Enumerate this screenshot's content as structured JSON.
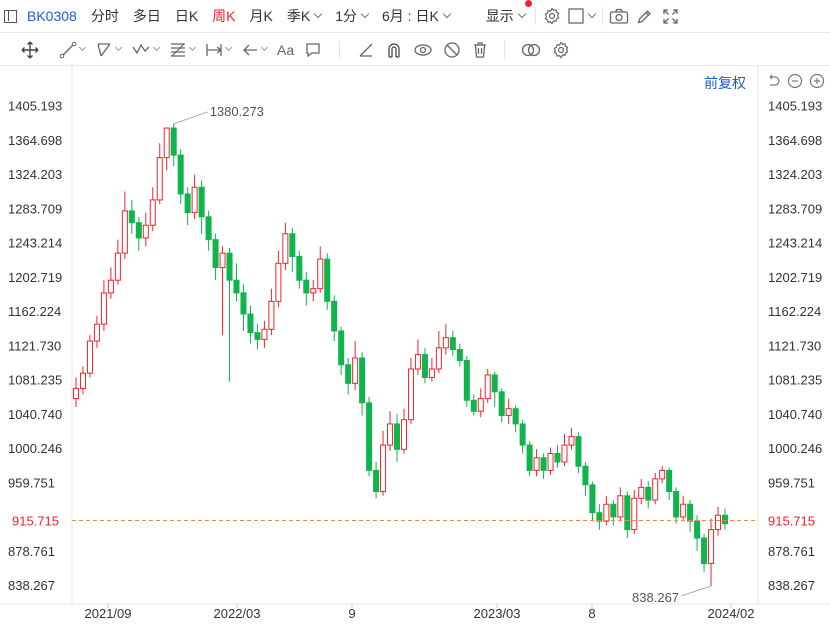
{
  "toolbar": {
    "symbol": "BK0308",
    "periods": [
      "分时",
      "多日",
      "日K",
      "周K",
      "月K",
      "季K",
      "1分"
    ],
    "active_period": "周K",
    "combo": "6月 : 日K",
    "display": "显示"
  },
  "drawbar": {
    "text_tool": "Aa"
  },
  "chart": {
    "adjust_label": "前复权",
    "current_price": "915.715"
  },
  "chart_data": {
    "type": "candlestick",
    "y_ticks": [
      "1405.193",
      "1364.698",
      "1324.203",
      "1283.709",
      "1243.214",
      "1202.719",
      "1162.224",
      "1121.730",
      "1081.235",
      "1040.740",
      "1000.246",
      "959.751",
      "878.761",
      "838.267"
    ],
    "ylim": [
      817,
      1425
    ],
    "x_ticks": [
      "2021/09",
      "2022/03",
      "9",
      "2023/03",
      "8",
      "2024/02"
    ],
    "high_label": "1380.273",
    "low_label": "838.267",
    "current_price": 915.715,
    "colors": {
      "up": "#f5222d",
      "down": "#10b44c",
      "price_line": "#f0883e"
    },
    "candles": [
      [
        1060,
        1072,
        1085,
        1050
      ],
      [
        1072,
        1090,
        1098,
        1065
      ],
      [
        1090,
        1128,
        1135,
        1085
      ],
      [
        1128,
        1148,
        1158,
        1120
      ],
      [
        1148,
        1185,
        1200,
        1140
      ],
      [
        1185,
        1200,
        1215,
        1178
      ],
      [
        1200,
        1232,
        1248,
        1195
      ],
      [
        1232,
        1282,
        1305,
        1225
      ],
      [
        1282,
        1268,
        1295,
        1255
      ],
      [
        1268,
        1250,
        1275,
        1235
      ],
      [
        1250,
        1265,
        1280,
        1240
      ],
      [
        1265,
        1295,
        1310,
        1258
      ],
      [
        1295,
        1345,
        1362,
        1290
      ],
      [
        1345,
        1380,
        1380.273,
        1330
      ],
      [
        1380,
        1348,
        1385,
        1335
      ],
      [
        1348,
        1302,
        1355,
        1290
      ],
      [
        1302,
        1280,
        1310,
        1265
      ],
      [
        1280,
        1310,
        1325,
        1272
      ],
      [
        1310,
        1275,
        1318,
        1255
      ],
      [
        1275,
        1248,
        1282,
        1235
      ],
      [
        1248,
        1215,
        1255,
        1200
      ],
      [
        1215,
        1232,
        1240,
        1135
      ],
      [
        1232,
        1200,
        1238,
        1080
      ],
      [
        1200,
        1185,
        1220,
        1175
      ],
      [
        1185,
        1160,
        1195,
        1140
      ],
      [
        1160,
        1138,
        1170,
        1125
      ],
      [
        1138,
        1130,
        1148,
        1118
      ],
      [
        1130,
        1142,
        1152,
        1120
      ],
      [
        1142,
        1175,
        1190,
        1135
      ],
      [
        1175,
        1220,
        1235,
        1168
      ],
      [
        1220,
        1255,
        1268,
        1212
      ],
      [
        1255,
        1228,
        1262,
        1210
      ],
      [
        1228,
        1200,
        1235,
        1190
      ],
      [
        1200,
        1185,
        1210,
        1170
      ],
      [
        1185,
        1190,
        1200,
        1175
      ],
      [
        1190,
        1225,
        1240,
        1185
      ],
      [
        1225,
        1175,
        1232,
        1165
      ],
      [
        1175,
        1140,
        1182,
        1128
      ],
      [
        1140,
        1100,
        1145,
        1088
      ],
      [
        1100,
        1078,
        1108,
        1065
      ],
      [
        1078,
        1108,
        1128,
        1070
      ],
      [
        1108,
        1055,
        1115,
        1040
      ],
      [
        1055,
        975,
        1062,
        968
      ],
      [
        975,
        950,
        985,
        942
      ],
      [
        950,
        1005,
        1022,
        945
      ],
      [
        1005,
        1030,
        1045,
        998
      ],
      [
        1030,
        1000,
        1042,
        985
      ],
      [
        1000,
        1035,
        1048,
        995
      ],
      [
        1035,
        1095,
        1108,
        1030
      ],
      [
        1095,
        1112,
        1130,
        1088
      ],
      [
        1112,
        1085,
        1120,
        1078
      ],
      [
        1085,
        1095,
        1108,
        1080
      ],
      [
        1095,
        1120,
        1140,
        1090
      ],
      [
        1120,
        1132,
        1148,
        1112
      ],
      [
        1132,
        1118,
        1140,
        1110
      ],
      [
        1118,
        1105,
        1125,
        1098
      ],
      [
        1105,
        1058,
        1110,
        1050
      ],
      [
        1058,
        1045,
        1065,
        1040
      ],
      [
        1045,
        1060,
        1072,
        1038
      ],
      [
        1060,
        1088,
        1095,
        1055
      ],
      [
        1088,
        1068,
        1092,
        1050
      ],
      [
        1068,
        1040,
        1072,
        1032
      ],
      [
        1040,
        1048,
        1060,
        1030
      ],
      [
        1048,
        1030,
        1052,
        1020
      ],
      [
        1030,
        1005,
        1035,
        995
      ],
      [
        1005,
        975,
        1010,
        968
      ],
      [
        975,
        990,
        1000,
        968
      ],
      [
        990,
        975,
        995,
        965
      ],
      [
        975,
        995,
        1002,
        970
      ],
      [
        995,
        985,
        1005,
        978
      ],
      [
        985,
        1005,
        1018,
        980
      ],
      [
        1005,
        1015,
        1025,
        1000
      ],
      [
        1015,
        980,
        1020,
        972
      ],
      [
        980,
        958,
        985,
        945
      ],
      [
        958,
        925,
        962,
        915
      ],
      [
        925,
        915,
        935,
        905
      ],
      [
        915,
        935,
        945,
        910
      ],
      [
        935,
        920,
        940,
        910
      ],
      [
        920,
        945,
        955,
        915
      ],
      [
        945,
        905,
        950,
        895
      ],
      [
        905,
        942,
        952,
        900
      ],
      [
        942,
        955,
        965,
        935
      ],
      [
        955,
        940,
        962,
        930
      ],
      [
        940,
        965,
        972,
        935
      ],
      [
        965,
        975,
        980,
        960
      ],
      [
        975,
        950,
        978,
        940
      ],
      [
        950,
        920,
        955,
        912
      ],
      [
        920,
        935,
        945,
        915
      ],
      [
        935,
        915,
        940,
        902
      ],
      [
        915,
        895,
        922,
        880
      ],
      [
        895,
        865,
        900,
        855
      ],
      [
        865,
        905,
        918,
        838.267
      ],
      [
        905,
        922,
        932,
        898
      ],
      [
        922,
        912,
        930,
        905
      ]
    ]
  }
}
